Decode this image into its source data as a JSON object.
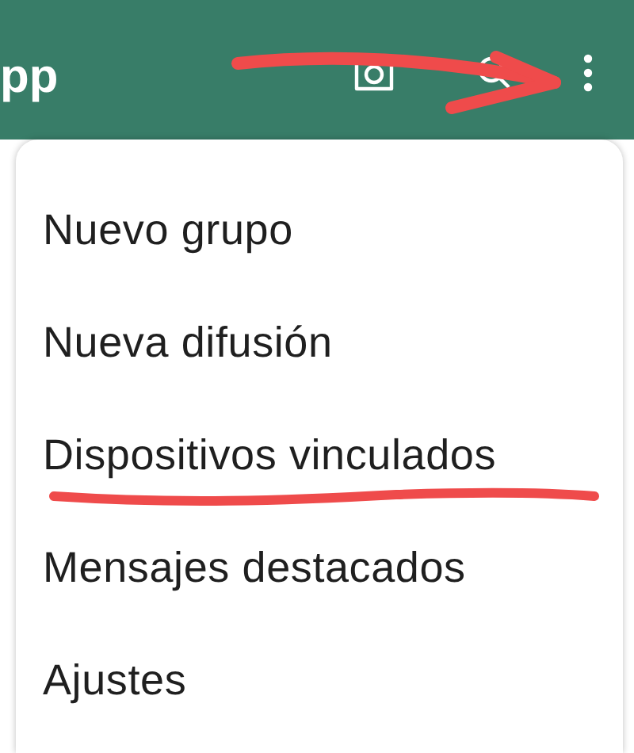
{
  "app_bar": {
    "title": "pp"
  },
  "menu": {
    "items": [
      {
        "label": "Nuevo grupo",
        "underlined": false
      },
      {
        "label": "Nueva difusión",
        "underlined": false
      },
      {
        "label": "Dispositivos vinculados",
        "underlined": true
      },
      {
        "label": "Mensajes destacados",
        "underlined": false
      },
      {
        "label": "Ajustes",
        "underlined": false
      }
    ]
  }
}
